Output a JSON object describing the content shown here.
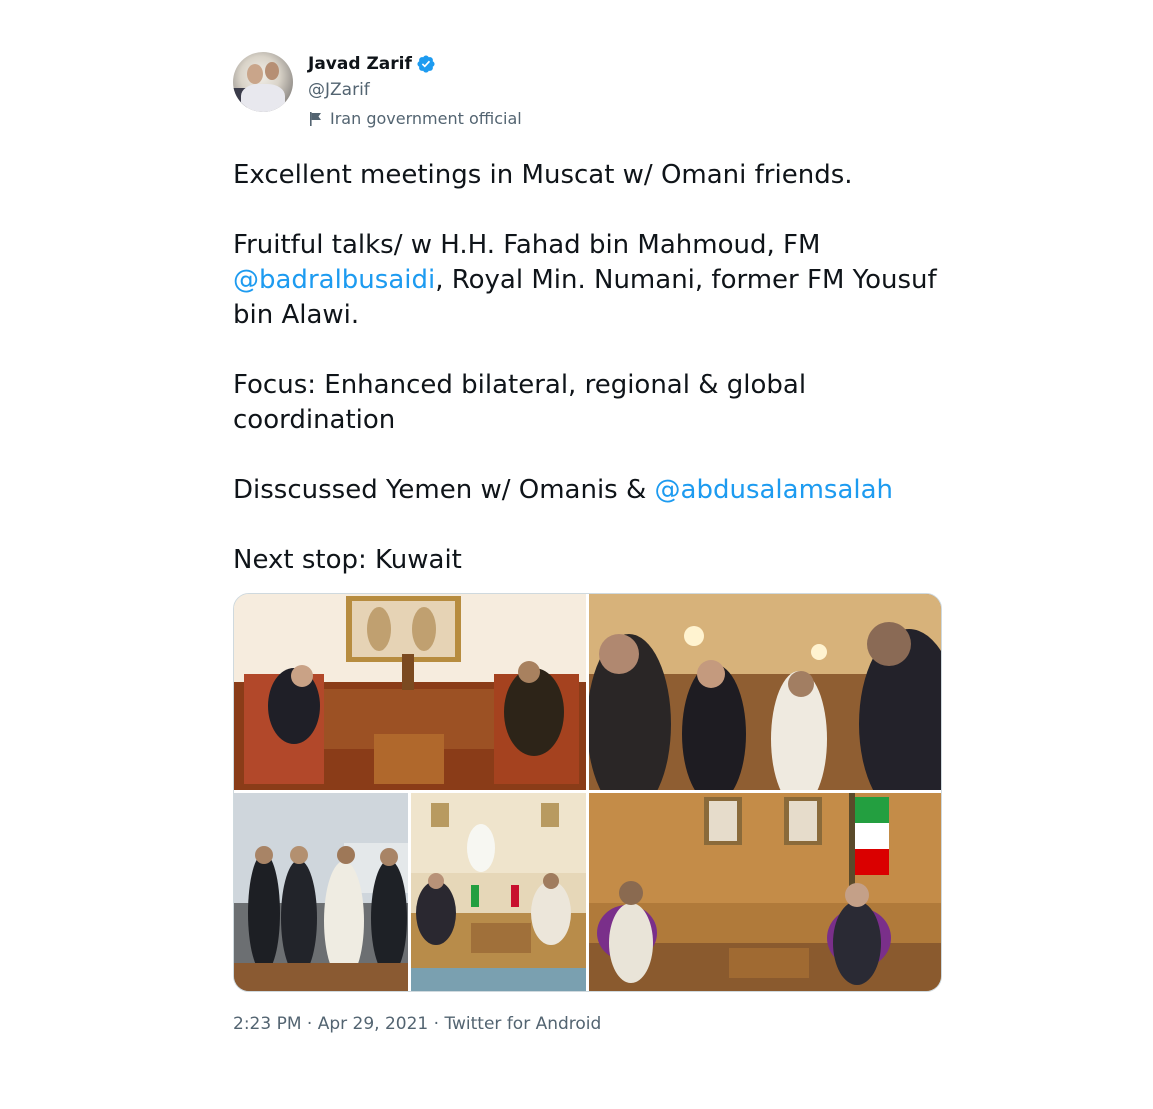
{
  "author": {
    "name": "Javad Zarif",
    "handle": "@JZarif",
    "label": "Iran government official",
    "verified": true
  },
  "tweet": {
    "p1": "Excellent meetings in Muscat w/ Omani friends.",
    "p2_a": "Fruitful talks/ w H.H. Fahad bin Mahmoud, FM",
    "p2_mention": "@badralbusaidi",
    "p2_b": ", Royal Min. Numani, former FM Yousuf bin Alawi.",
    "p3": "Focus: Enhanced bilateral, regional & global coordination",
    "p4_a": "Disscussed Yemen w/ Omanis & ",
    "p4_mention": "@abdusalamsalah",
    "p5": "Next stop: Kuwait"
  },
  "meta": {
    "text": "2:23 PM · Apr 29, 2021 · Twitter for Android"
  },
  "colors": {
    "link": "#1d9bf0",
    "secondary_text": "#536471",
    "verified_badge": "#1d9bf0"
  }
}
